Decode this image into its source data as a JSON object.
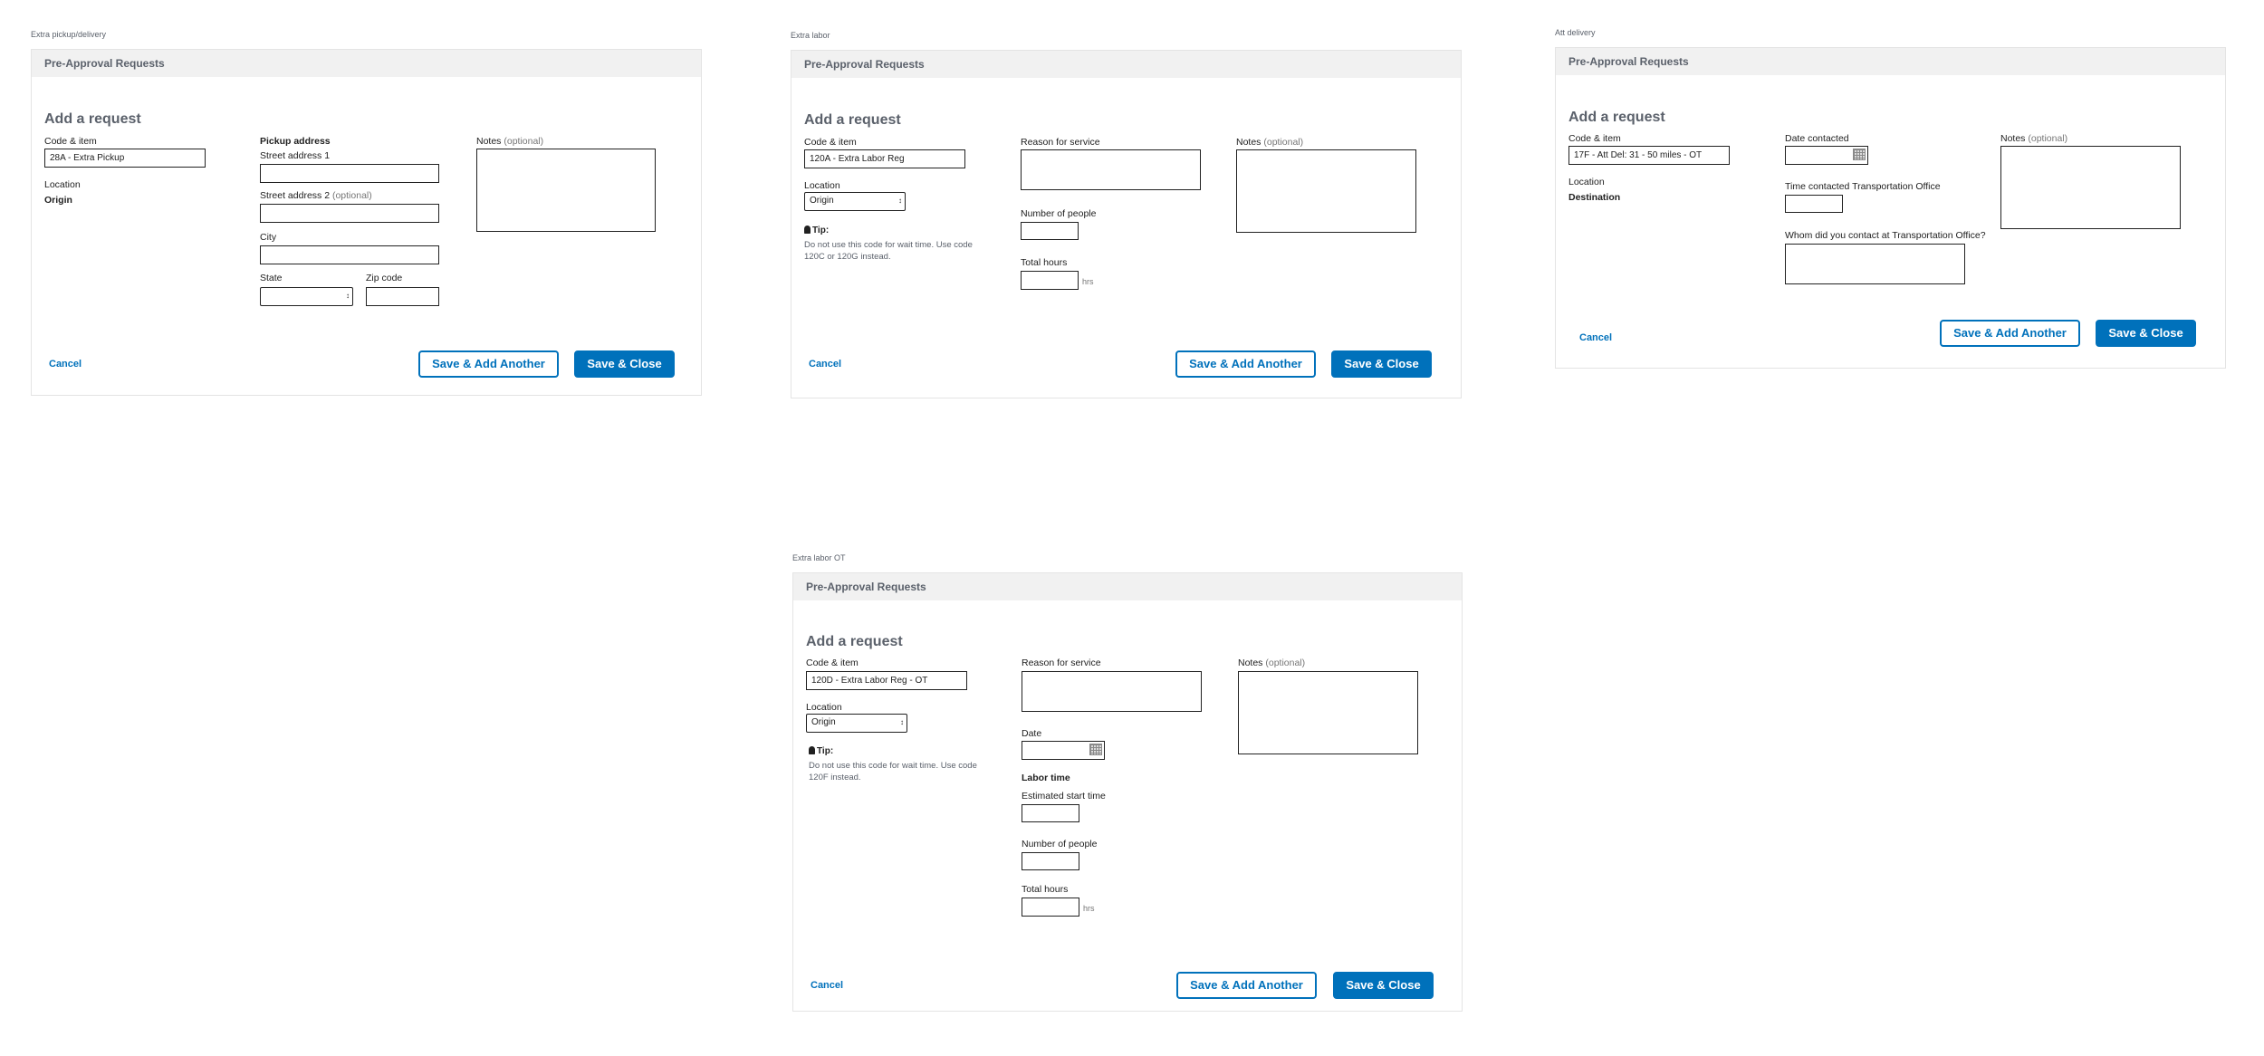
{
  "common": {
    "header": "Pre-Approval Requests",
    "heading": "Add a request",
    "code_item_label": "Code & item",
    "location_label": "Location",
    "notes_label": "Notes",
    "optional": "(optional)",
    "cancel": "Cancel",
    "save_add_another": "Save & Add Another",
    "save_close": "Save & Close",
    "tip_label": "Tip:",
    "hrs": "hrs"
  },
  "panel1": {
    "caption": "Extra pickup/delivery",
    "code_value": "28A - Extra Pickup",
    "location_value": "Origin",
    "pickup_address": "Pickup address",
    "street1": "Street address 1",
    "street2": "Street address 2",
    "city": "City",
    "state": "State",
    "zip": "Zip code"
  },
  "panel2": {
    "caption": "Extra labor",
    "code_value": "120A - Extra Labor Reg",
    "location_value": "Origin",
    "tip_text": "Do not use this code for wait time. Use code 120C or 120G instead.",
    "reason": "Reason for service",
    "people": "Number of people",
    "hours": "Total hours"
  },
  "panel3": {
    "caption": "Att delivery",
    "code_value": "17F - Att Del: 31 - 50 miles - OT",
    "location_value": "Destination",
    "date_contacted": "Date contacted",
    "time_contacted": "Time contacted Transportation Office",
    "whom": "Whom did you contact at Transportation Office?"
  },
  "panel4": {
    "caption": "Extra labor OT",
    "code_value": "120D - Extra Labor Reg - OT",
    "location_value": "Origin",
    "tip_text": "Do not use this code for wait time. Use code 120F instead.",
    "reason": "Reason for service",
    "date": "Date",
    "labor_time": "Labor time",
    "est_start": "Estimated start time",
    "people": "Number of people",
    "hours": "Total hours"
  },
  "colors": {
    "primary": "#0071bb",
    "header_bg": "#f1f1f1",
    "muted": "#5b616b"
  },
  "icons": [
    "calendar-icon",
    "lightbulb-icon",
    "select-arrows-icon"
  ]
}
